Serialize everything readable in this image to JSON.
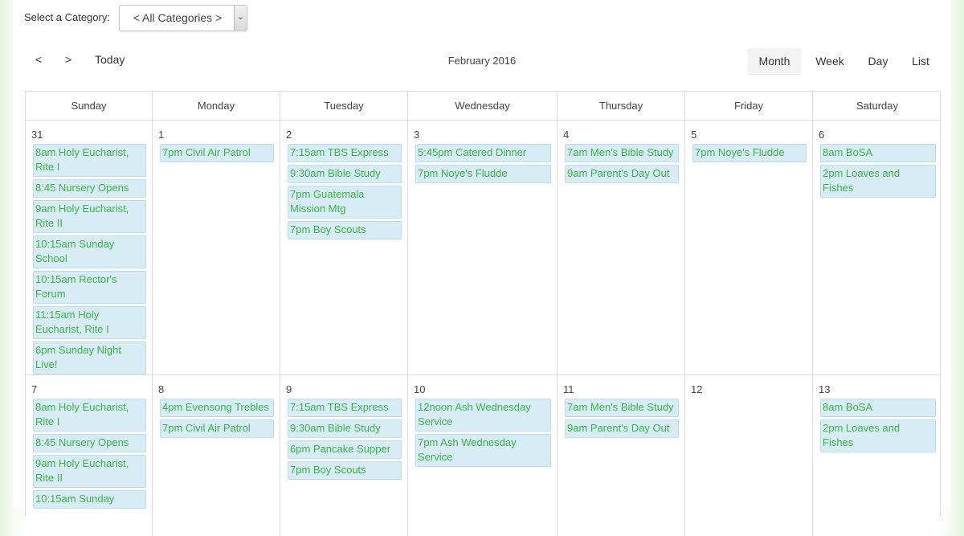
{
  "filter": {
    "label": "Select a Category:",
    "value": "< All Categories >",
    "arrow": "⌄"
  },
  "toolbar": {
    "prev": "<",
    "next": ">",
    "today": "Today",
    "title": "February 2016",
    "views": [
      "Month",
      "Week",
      "Day",
      "List"
    ],
    "active_view": "Month"
  },
  "weekdays": [
    "Sunday",
    "Monday",
    "Tuesday",
    "Wednesday",
    "Thursday",
    "Friday",
    "Saturday"
  ],
  "weeks": [
    [
      {
        "num": "31",
        "events": [
          "8am Holy Eucharist, Rite I",
          "8:45 Nursery Opens",
          "9am Holy Eucharist, Rite II",
          "10:15am Sunday School",
          "10:15am Rector's Forum",
          "11:15am Holy Eucharist, Rite I",
          "6pm Sunday Night Live!"
        ]
      },
      {
        "num": "1",
        "events": [
          "7pm Civil Air Patrol"
        ]
      },
      {
        "num": "2",
        "events": [
          "7:15am TBS Express",
          "9:30am Bible Study",
          "7pm Guatemala Mission Mtg",
          "7pm Boy Scouts"
        ]
      },
      {
        "num": "3",
        "events": [
          "5:45pm Catered Dinner",
          "7pm Noye's Fludde"
        ]
      },
      {
        "num": "4",
        "events": [
          "7am Men's Bible Study",
          "9am Parent's Day Out"
        ]
      },
      {
        "num": "5",
        "events": [
          "7pm Noye's Fludde"
        ]
      },
      {
        "num": "6",
        "events": [
          "8am BoSA",
          "2pm Loaves and Fishes"
        ]
      }
    ],
    [
      {
        "num": "7",
        "events": [
          "8am Holy Eucharist, Rite I",
          "8:45 Nursery Opens",
          "9am Holy Eucharist, Rite II",
          "10:15am Sunday"
        ]
      },
      {
        "num": "8",
        "events": [
          "4pm Evensong Trebles",
          "7pm Civil Air Patrol"
        ]
      },
      {
        "num": "9",
        "events": [
          "7:15am TBS Express",
          "9:30am Bible Study",
          "6pm Pancake Supper",
          "7pm Boy Scouts"
        ]
      },
      {
        "num": "10",
        "events": [
          "12noon Ash Wednesday Service",
          "7pm Ash Wednesday Service"
        ]
      },
      {
        "num": "11",
        "events": [
          "7am Men's Bible Study",
          "9am Parent's Day Out"
        ]
      },
      {
        "num": "12",
        "events": []
      },
      {
        "num": "13",
        "events": [
          "8am BoSA",
          "2pm Loaves and Fishes"
        ]
      }
    ]
  ],
  "colors": {
    "event_bg": "#d7ecf5",
    "event_text": "#3cb348",
    "grid": "#dddddd"
  }
}
